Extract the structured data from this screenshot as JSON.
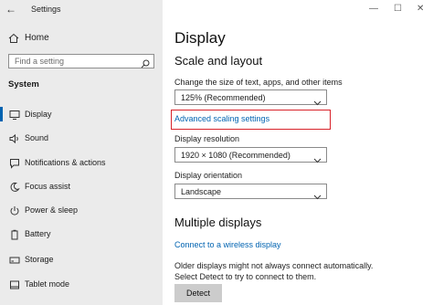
{
  "window": {
    "title": "Settings",
    "back_glyph": "←",
    "minimize_glyph": "—",
    "maximize_glyph": "☐",
    "close_glyph": "✕"
  },
  "sidebar": {
    "home_label": "Home",
    "search_placeholder": "Find a setting",
    "section_label": "System",
    "items": [
      {
        "label": "Display",
        "icon": "monitor-icon",
        "active": true
      },
      {
        "label": "Sound",
        "icon": "speaker-icon"
      },
      {
        "label": "Notifications & actions",
        "icon": "notification-icon"
      },
      {
        "label": "Focus assist",
        "icon": "moon-icon"
      },
      {
        "label": "Power & sleep",
        "icon": "power-icon"
      },
      {
        "label": "Battery",
        "icon": "battery-icon"
      },
      {
        "label": "Storage",
        "icon": "storage-icon"
      },
      {
        "label": "Tablet mode",
        "icon": "tablet-icon"
      }
    ]
  },
  "main": {
    "title": "Display",
    "scale_heading": "Scale and layout",
    "scale_label": "Change the size of text, apps, and other items",
    "scale_value": "125% (Recommended)",
    "advanced_link": "Advanced scaling settings",
    "resolution_label": "Display resolution",
    "resolution_value": "1920 × 1080 (Recommended)",
    "orientation_label": "Display orientation",
    "orientation_value": "Landscape",
    "multiple_heading": "Multiple displays",
    "wireless_link": "Connect to a wireless display",
    "older_text": "Older displays might not always connect automatically. Select Detect to try to connect to them.",
    "detect_button": "Detect"
  },
  "colors": {
    "accent": "#0063b1",
    "highlight": "#d8222a",
    "sidebar_bg": "#ebebeb"
  }
}
